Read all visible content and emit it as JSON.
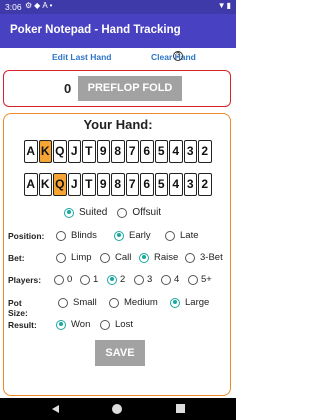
{
  "status_bar": {
    "time": "3:06",
    "left_icons": [
      "gear-icon",
      "shield-icon",
      "a-icon",
      "dot-icon"
    ],
    "right_icons": [
      "wifi-icon",
      "battery-icon"
    ]
  },
  "app_bar": {
    "title": "Poker Notepad - Hand Tracking"
  },
  "links": {
    "edit_last_hand": "Edit Last Hand",
    "clear_hand": "Clear Hand",
    "help": "?"
  },
  "result": {
    "count": "0",
    "button_label": "PREFLOP FOLD"
  },
  "hand": {
    "heading": "Your Hand:",
    "card_row_1": [
      "A",
      "K",
      "Q",
      "J",
      "T",
      "9",
      "8",
      "7",
      "6",
      "5",
      "4",
      "3",
      "2"
    ],
    "card_row_1_selected": "K",
    "card_row_2": [
      "A",
      "K",
      "Q",
      "J",
      "T",
      "9",
      "8",
      "7",
      "6",
      "5",
      "4",
      "3",
      "2"
    ],
    "card_row_2_selected": "Q",
    "suit_options": [
      "Suited",
      "Offsuit"
    ],
    "suit_selected": "Suited"
  },
  "position": {
    "label": "Position:",
    "options": [
      "Blinds",
      "Early",
      "Late"
    ],
    "selected": "Early"
  },
  "bet": {
    "label": "Bet:",
    "options": [
      "Limp",
      "Call",
      "Raise",
      "3-Bet"
    ],
    "selected": "Raise"
  },
  "players": {
    "label": "Players:",
    "options": [
      "0",
      "1",
      "2",
      "3",
      "4",
      "5+"
    ],
    "selected": "2"
  },
  "pot_size": {
    "label": "Pot Size:",
    "options": [
      "Small",
      "Medium",
      "Large"
    ],
    "selected": "Large"
  },
  "result_row": {
    "label": "Result:",
    "options": [
      "Won",
      "Lost"
    ],
    "selected": "Won"
  },
  "save_label": "SAVE",
  "colors": {
    "status_bar": "#3f3aa9",
    "app_bar": "#4842c2",
    "accent": "#1aa89e",
    "selected_card": "#f6a433",
    "link": "#2d74c8",
    "result_border": "#d8222a",
    "panel_border": "#ef8a2a"
  }
}
